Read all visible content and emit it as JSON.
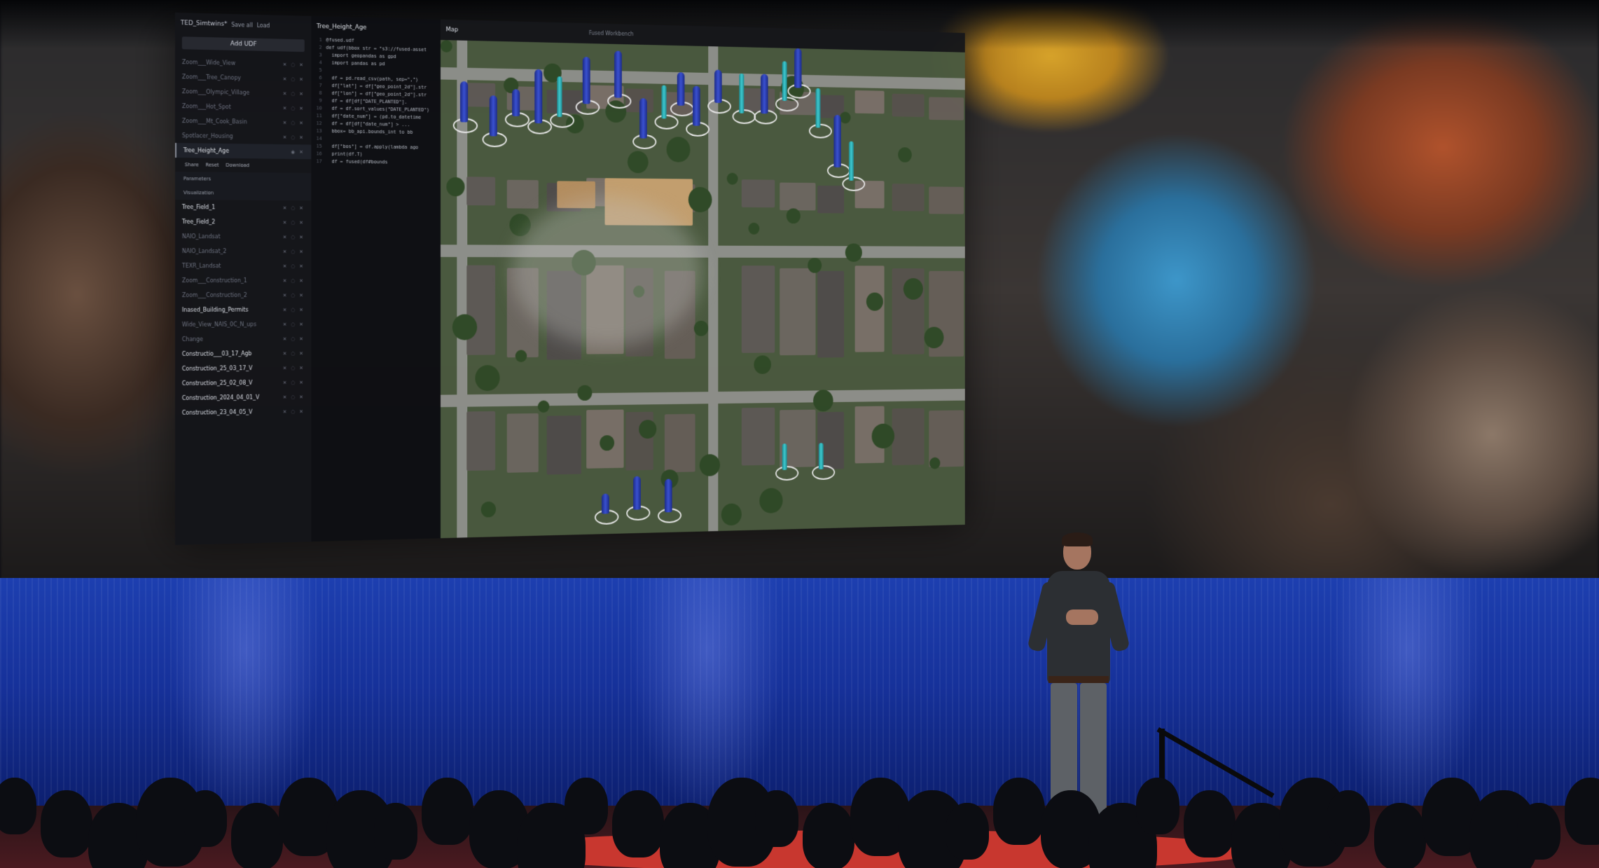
{
  "app": {
    "project_title": "TED_Simtwins*",
    "sidebar_actions": [
      "Save all",
      "Load"
    ],
    "add_button": "Add UDF",
    "layers_top": [
      "Zoom___Wide_View",
      "Zoom___Tree_Canopy",
      "Zoom___Olympic_Village",
      "Zoom___Hot_Spot",
      "Zoom___Mt_Cook_Basin",
      "Spotlacer_Housing"
    ],
    "selected_layer": "Tree_Height_Age",
    "subbar": [
      "Share",
      "Reset",
      "Download"
    ],
    "sections": [
      "Parameters",
      "Visualization"
    ],
    "layers_bottom": [
      {
        "name": "Tree_Field_1",
        "bright": true
      },
      {
        "name": "Tree_Field_2",
        "bright": true
      },
      {
        "name": "NAIO_Landsat",
        "bright": false
      },
      {
        "name": "NAIO_Landsat_2",
        "bright": false
      },
      {
        "name": "TEXR_Landsat",
        "bright": false
      },
      {
        "name": "Zoom___Construction_1",
        "bright": false
      },
      {
        "name": "Zoom___Construction_2",
        "bright": false
      },
      {
        "name": "Inased_Building_Permits",
        "bright": true
      },
      {
        "name": "Wide_View_NAIS_0C_N_ups",
        "bright": false
      },
      {
        "name": "Change",
        "bright": false
      },
      {
        "name": "Constructio___03_17_Agb",
        "bright": true
      },
      {
        "name": "Construction_25_03_17_V",
        "bright": true
      },
      {
        "name": "Construction_25_02_08_V",
        "bright": true
      },
      {
        "name": "Construction_2024_04_01_V",
        "bright": true
      },
      {
        "name": "Construction_23_04_05_V",
        "bright": true
      }
    ],
    "code_tab": "Tree_Height_Age",
    "code_lines": [
      "@fused.udf",
      "def udf(bbox str = \"s3://fused-asset",
      "  import geopandas as gpd",
      "  import pandas as pd",
      "",
      "  df = pd.read_csv(path, sep=\",\")",
      "  df[\"lat\"] = df[\"geo_point_2d\"].str",
      "  df[\"lon\"] = df[\"geo_point_2d\"].str",
      "  df = df[df[\"DATE_PLANTED\"].",
      "  df = df.sort_values(\"DATE_PLANTED\")",
      "  df[\"date_num\"] = (pd.to_datetime",
      "  df = df[df[\"date_num\"] > ...",
      "  bbox= bb_api.bounds_int to bb",
      "",
      "  df[\"bos\"] = df.apply(lambda ago",
      "  print(df.T)",
      "  df = fused(df#bounds"
    ],
    "map_tab": "Map",
    "map_hint": "Fused Workbench"
  },
  "colors": {
    "pillar_blue": "#2a3fc0",
    "pillar_cyan": "#3fd2d8",
    "stage_blue": "#1d3fb0",
    "carpet_red": "#c8372f"
  }
}
